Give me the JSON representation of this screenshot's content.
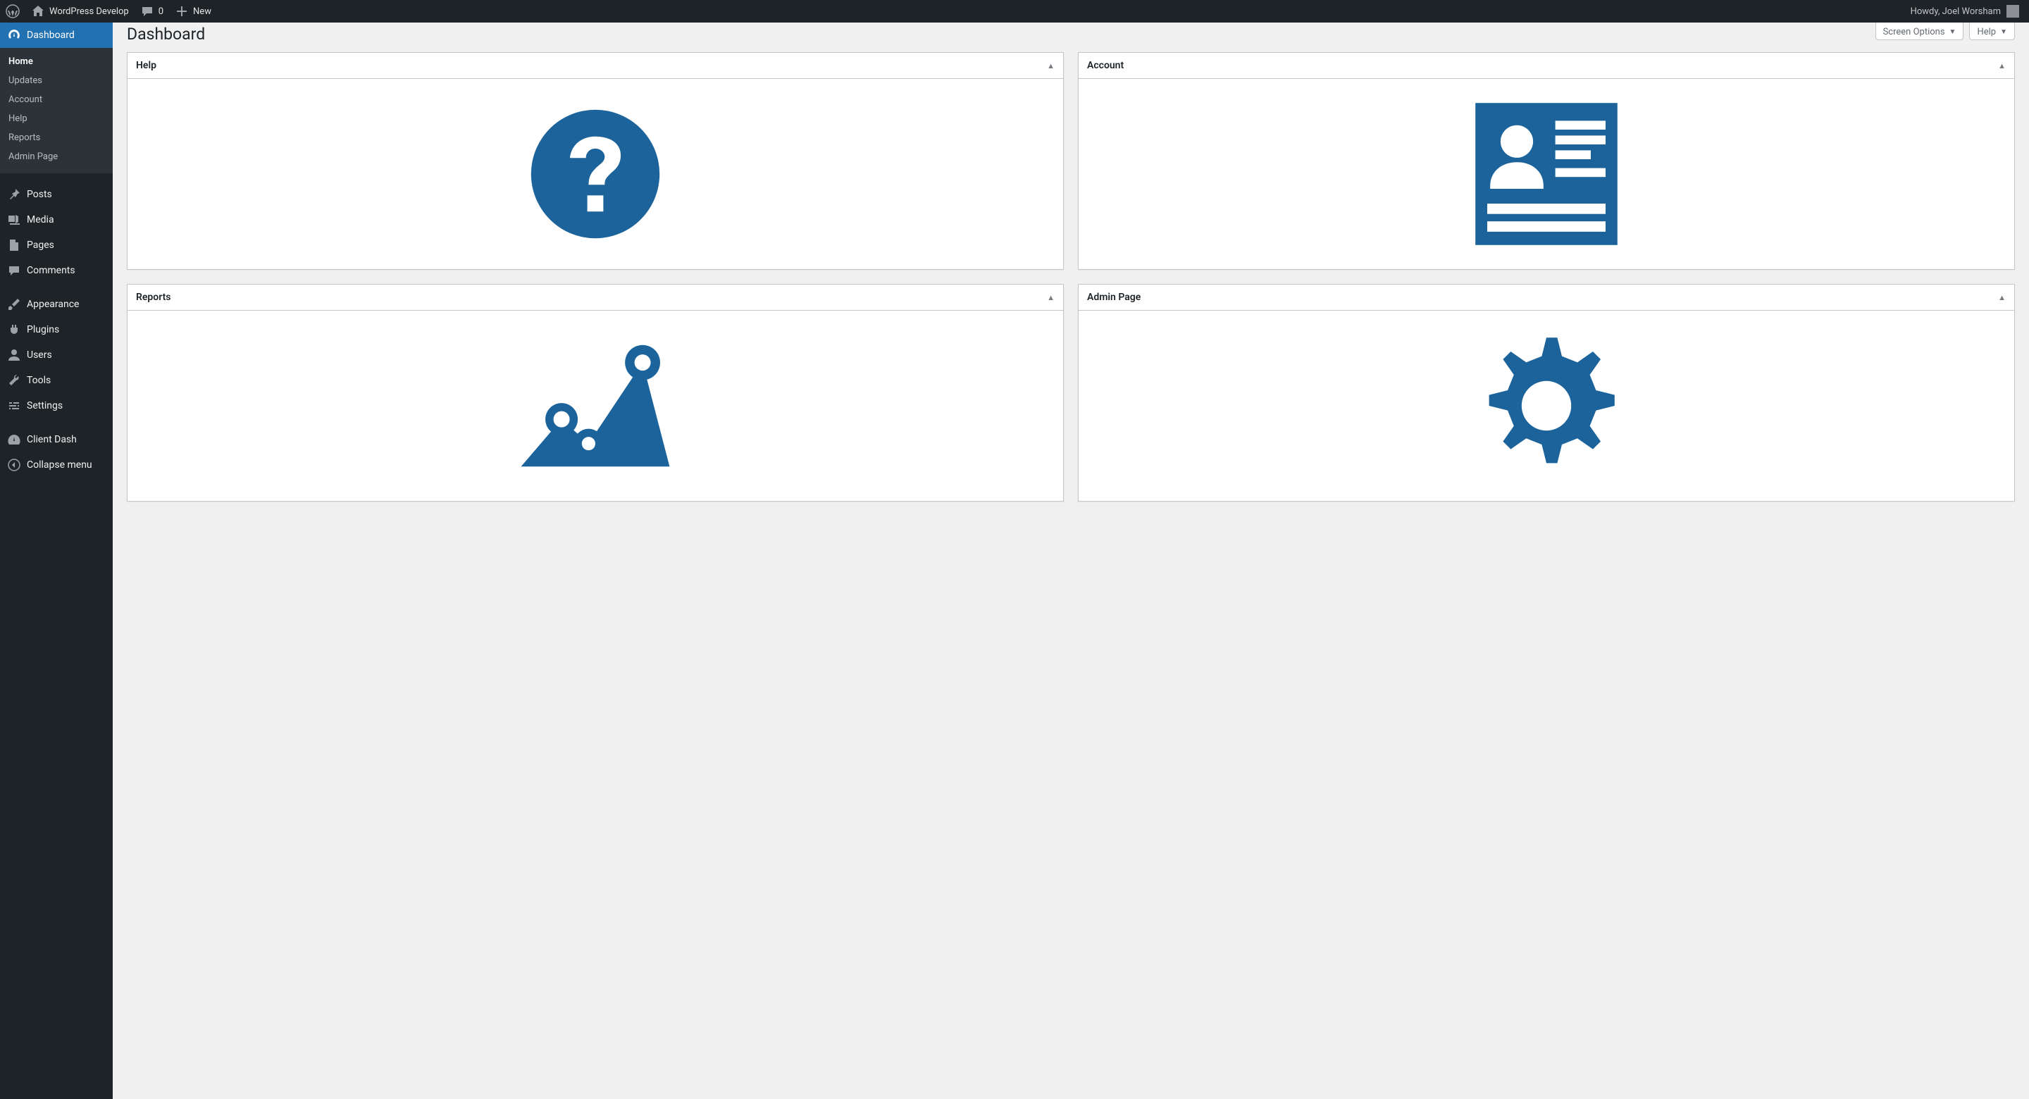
{
  "adminbar": {
    "site_name": "WordPress Develop",
    "comments_count": "0",
    "new_label": "New",
    "greeting": "Howdy, Joel Worsham"
  },
  "sidebar": {
    "dashboard_label": "Dashboard",
    "submenu": [
      {
        "label": "Home",
        "current": true
      },
      {
        "label": "Updates"
      },
      {
        "label": "Account"
      },
      {
        "label": "Help"
      },
      {
        "label": "Reports"
      },
      {
        "label": "Admin Page"
      }
    ],
    "items": [
      {
        "label": "Posts",
        "icon": "pin"
      },
      {
        "label": "Media",
        "icon": "media"
      },
      {
        "label": "Pages",
        "icon": "page"
      },
      {
        "label": "Comments",
        "icon": "comment"
      }
    ],
    "items2": [
      {
        "label": "Appearance",
        "icon": "brush"
      },
      {
        "label": "Plugins",
        "icon": "plug"
      },
      {
        "label": "Users",
        "icon": "user"
      },
      {
        "label": "Tools",
        "icon": "wrench"
      },
      {
        "label": "Settings",
        "icon": "sliders"
      }
    ],
    "items3": [
      {
        "label": "Client Dash",
        "icon": "gauge"
      }
    ],
    "collapse_label": "Collapse menu"
  },
  "top_buttons": {
    "screen_options": "Screen Options",
    "help": "Help"
  },
  "page": {
    "title": "Dashboard"
  },
  "widgets": [
    {
      "title": "Help",
      "icon": "question"
    },
    {
      "title": "Account",
      "icon": "profile"
    },
    {
      "title": "Reports",
      "icon": "chart"
    },
    {
      "title": "Admin Page",
      "icon": "gear"
    }
  ]
}
